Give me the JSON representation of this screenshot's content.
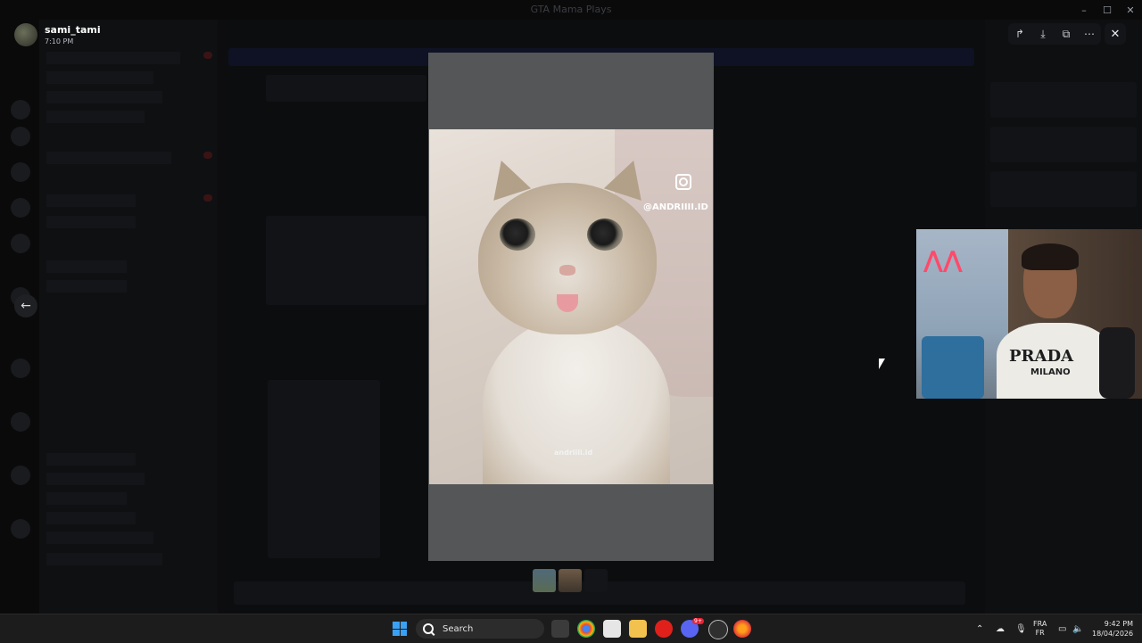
{
  "window": {
    "title": "GTA Mama Plays"
  },
  "viewer": {
    "user": {
      "name": "sami_tami",
      "time": "7:10 PM"
    },
    "photo": {
      "ig_handle": "@ANDRIIII.ID",
      "watermark": "andriiii.id"
    },
    "thumbnails": [
      "thumb-1",
      "thumb-2",
      "thumb-3"
    ]
  },
  "taskbar": {
    "search_label": "Search",
    "language": {
      "top": "FRA",
      "bottom": "FR"
    },
    "clock": {
      "time": "9:42 PM",
      "date": "18/04/2026"
    },
    "discord_badge": "9+"
  },
  "webcam": {
    "shirt_text": "PRADA",
    "shirt_subtext": "MILANO"
  },
  "colors": {
    "accent": "#3aa0f3",
    "overlay_bg": "#0b0b0c",
    "viewer_bg": "#555657"
  }
}
